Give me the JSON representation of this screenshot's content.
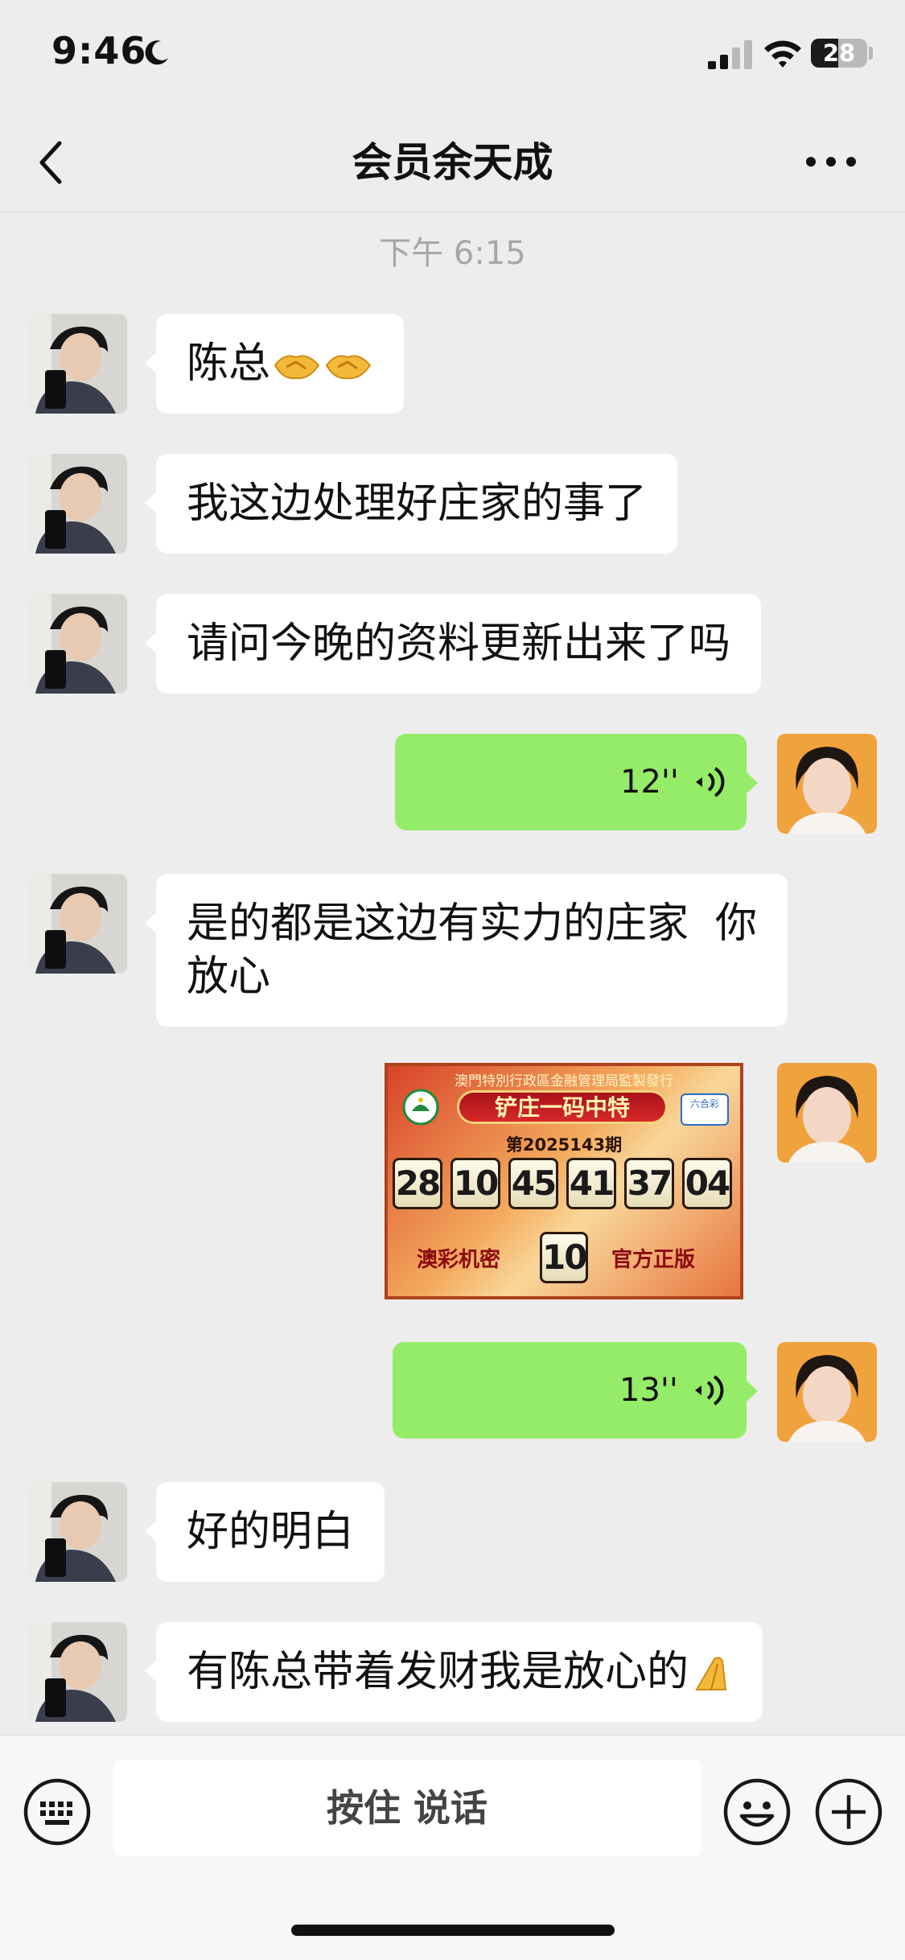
{
  "status_bar": {
    "time": "9:46",
    "battery": "28"
  },
  "header": {
    "title": "会员余天成"
  },
  "timestamp": "下午 6:15",
  "messages": [
    {
      "side": "in",
      "type": "text",
      "text": "陈总",
      "emoji": "handshake-emoji x2"
    },
    {
      "side": "in",
      "type": "text",
      "text": "我这边处理好庄家的事了"
    },
    {
      "side": "in",
      "type": "text",
      "text": "请问今晚的资料更新出来了吗"
    },
    {
      "side": "out",
      "type": "voice",
      "duration": "12''"
    },
    {
      "side": "in",
      "type": "text",
      "line1": "是的都是这边有实力的庄家  你",
      "line2": "放心"
    },
    {
      "side": "out",
      "type": "image",
      "image": {
        "top_text": "澳門特別行政區金融管理局監製發行",
        "banner": "铲庄一码中特",
        "logo_right": "六合彩",
        "issue": "第2025143期",
        "numbers": [
          "28",
          "10",
          "45",
          "41",
          "37",
          "04"
        ],
        "special": "10",
        "left_label": "澳彩机密",
        "right_label": "官方正版"
      }
    },
    {
      "side": "out",
      "type": "voice",
      "duration": "13''"
    },
    {
      "side": "in",
      "type": "text",
      "text": "好的明白"
    },
    {
      "side": "in",
      "type": "text",
      "text": "有陈总带着发财我是放心的",
      "emoji": "pray-emoji"
    }
  ],
  "input_bar": {
    "hold_to_talk": "按住 说话"
  },
  "colors": {
    "background": "#ededed",
    "incoming_bubble": "#ffffff",
    "outgoing_bubble": "#95ec69"
  }
}
